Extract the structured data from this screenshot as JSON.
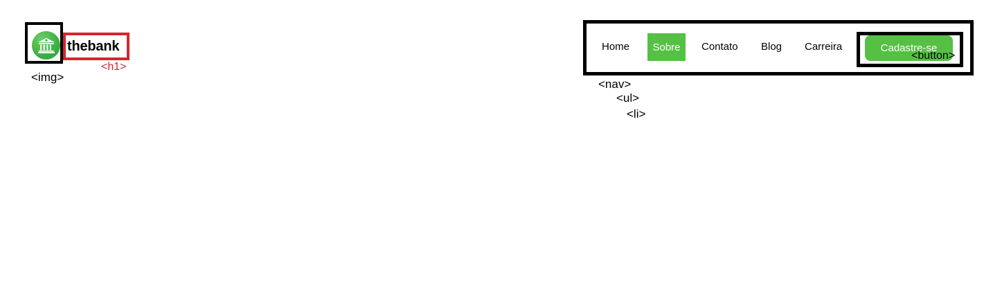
{
  "logo": {
    "icon": "bank-icon",
    "brand_name": "thebank",
    "color": "#3fb047"
  },
  "annotations": {
    "img": "<img>",
    "h1": "<h1>",
    "nav": "<nav>",
    "ul": "<ul>",
    "li": "<li>",
    "button": "<button>"
  },
  "nav": {
    "items": [
      {
        "label": "Home",
        "active": false
      },
      {
        "label": "Sobre",
        "active": true
      },
      {
        "label": "Contato",
        "active": false
      },
      {
        "label": "Blog",
        "active": false
      },
      {
        "label": "Carreira",
        "active": false
      }
    ],
    "cta_label": "Cadastre-se",
    "accent_color": "#55c043"
  },
  "colors": {
    "outline": "#000000",
    "h1_outline": "#d6262f"
  }
}
